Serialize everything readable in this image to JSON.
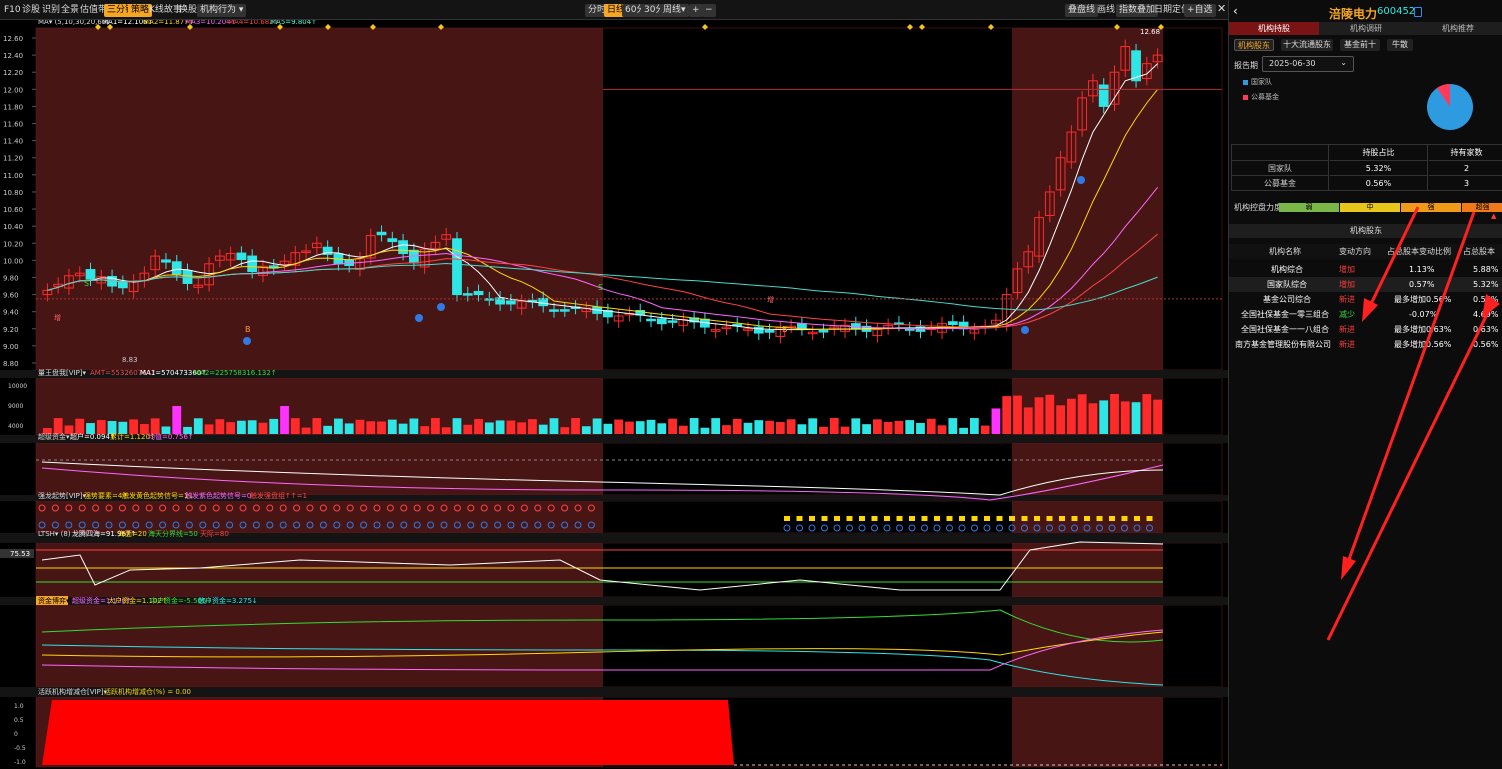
{
  "toolbar": {
    "items": [
      "F10",
      "诊股",
      "识别",
      "全景",
      "估值带",
      "三分钟",
      "策略",
      "K线故事",
      "换股",
      "机构行为"
    ],
    "center": [
      "分时",
      "日线",
      "60分",
      "30分",
      "周线"
    ],
    "right": [
      "叠盘线",
      "画线",
      "指数叠加",
      "日期定位",
      "+自选"
    ]
  },
  "main_legend": {
    "name": "MA",
    "params": "(5,10,30,20,60)",
    "ma1": "MA1=12.106↑",
    "ma2": "MA2=11.877↑",
    "ma3": "MA3=10.204↑",
    "ma4": "MA4=10.682↑",
    "ma5": "MA5=9.804↑"
  },
  "y_labels": [
    "12.60",
    "12.40",
    "12.20",
    "12.00",
    "11.80",
    "11.60",
    "11.40",
    "11.20",
    "11.00",
    "10.80",
    "10.60",
    "10.40",
    "10.20",
    "10.00",
    "9.80",
    "9.60",
    "9.40",
    "9.20",
    "9.00",
    "8.80"
  ],
  "price_notes": {
    "low": "8.83",
    "high": "12.68",
    "zeng1": "增",
    "zeng2": "增",
    "s1": "S",
    "s2": "S",
    "b1": "B",
    "b2": "B"
  },
  "panels": {
    "vol": {
      "title": "量王盘我[VIP]▾",
      "amt": "AMT=553260764↑",
      "ma1": "MA1=570473360↑",
      "ma2": "MA2=225758316.132↑",
      "y": [
        "10000",
        "9000",
        "4000"
      ]
    },
    "superfund": {
      "title": "超级资金▾",
      "a": "超户=0.094↑",
      "b": "累计=1.120↑",
      "c": "均值=0.756↑"
    },
    "strong": {
      "title": "强龙起势[VIP]▾",
      "a": "强势要素=4↑",
      "b": "触发黄色起势信号=1↓",
      "c": "触发紫色起势信号=0",
      "d": "触发强盘组↑↑=1"
    },
    "ltsh": {
      "title": "LTSH▾",
      "params": "(8)",
      "a": "龙腾四海=91.967↑",
      "b": "海面=20",
      "c": "海天分界线=50",
      "d": "天际=80",
      "val": "75.53"
    },
    "fundflow": {
      "title": "资金博弈▾",
      "a": "超级资金=1.120↑",
      "b": "大户资金=1.102↑",
      "c": "中户资金=-5.505↓",
      "d": "散户资金=3.275↓"
    },
    "inst": {
      "title": "活跃机构增减仓[VIP]▾",
      "a": "活跃机构增减仓(%) = 0.00",
      "y": [
        "1.0",
        "0.5",
        "0",
        "-0.5",
        "-1.0"
      ]
    }
  },
  "right_panel": {
    "stock_name": "涪陵电力",
    "stock_code": "600452",
    "tabs": [
      "机构持股",
      "机构调研",
      "机构推荐"
    ],
    "subtabs": [
      "机构股东",
      "十大流通股东",
      "基金前十",
      "牛散"
    ],
    "period_label": "报告期",
    "period_value": "2025-06-30",
    "legend": [
      "国家队",
      "公募基金"
    ],
    "table1": {
      "headers": [
        "",
        "持股占比",
        "持有家数"
      ],
      "rows": [
        [
          "国家队",
          "5.32%",
          "2"
        ],
        [
          "公募基金",
          "0.56%",
          "3"
        ]
      ]
    },
    "control": {
      "label": "机构控盘力度",
      "levels": [
        "弱",
        "中",
        "强",
        "超强"
      ]
    },
    "table2_title": "机构股东",
    "table2": {
      "headers": [
        "机构名称",
        "变动方向",
        "占总股本变动比例",
        "占总股本"
      ],
      "rows": [
        [
          "机构综合",
          "增加",
          "1.13%",
          "5.88%"
        ],
        [
          "国家队综合",
          "增加",
          "0.57%",
          "5.32%"
        ],
        [
          "基金公司综合",
          "新进",
          "最多增加0.56%",
          "0.56%"
        ],
        [
          "全国社保基金一零三组合",
          "减少",
          "-0.07%",
          "4.69%"
        ],
        [
          "全国社保基金一一八组合",
          "新进",
          "最多增加0.63%",
          "0.63%"
        ],
        [
          "南方基金管理股份有限公司",
          "新进",
          "最多增加0.56%",
          "0.56%"
        ]
      ]
    }
  },
  "colors": {
    "up": "#ff2a2a",
    "down": "#2ee6e6",
    "accent": "#f5a623",
    "bg": "#000000"
  }
}
